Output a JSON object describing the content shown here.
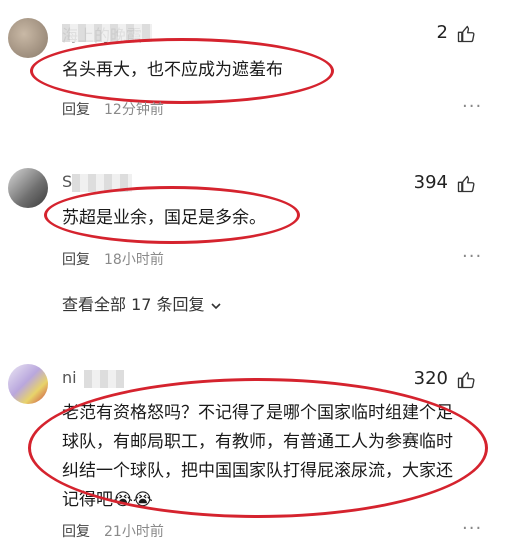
{
  "comments": [
    {
      "name": "海上的晚霞",
      "likes": "2",
      "text": "名头再大，也不应成为遮羞布",
      "reply_label": "回复",
      "time": "12分钟前"
    },
    {
      "name": "S",
      "likes": "394",
      "text": "苏超是业余，国足是多余。",
      "reply_label": "回复",
      "time": "18小时前",
      "expand_label": "查看全部 17 条回复"
    },
    {
      "name": "ni",
      "likes": "320",
      "text_lines": [
        "老范有资格怒吗？不记得了是哪个国家临时组建个足",
        "球队，有邮局职工，有教师，有普通工人为参赛临时",
        "纠结一个球队，把中国国家队打得屁滚尿流，大家还",
        "记得吧"
      ],
      "emoji": "😭😭",
      "reply_label": "回复",
      "time": "21小时前"
    }
  ],
  "icons": {
    "like": "thumb-up-icon",
    "more": "more-dots-icon",
    "expand": "chevron-down-icon"
  },
  "colors": {
    "highlight": "#d5232e"
  }
}
